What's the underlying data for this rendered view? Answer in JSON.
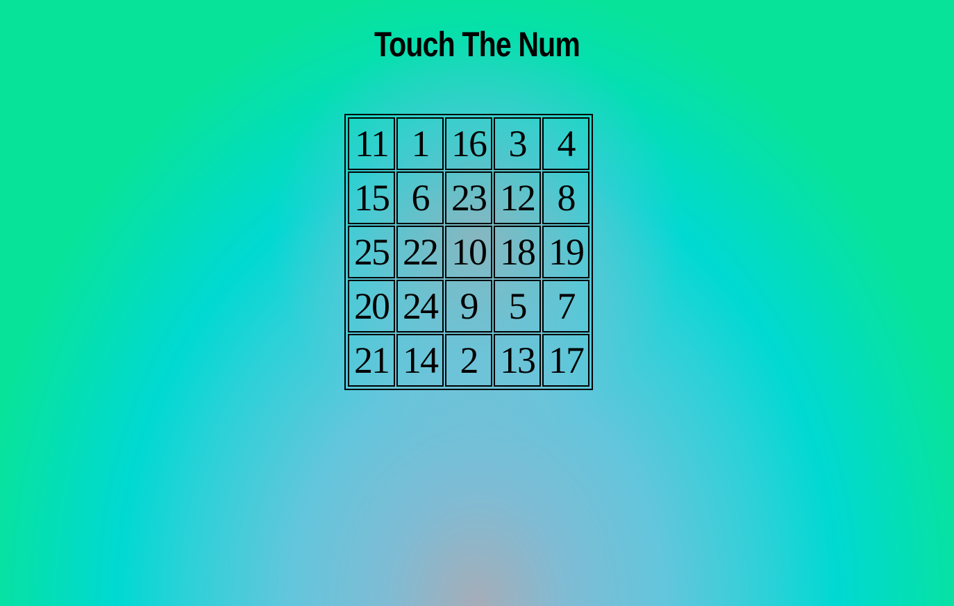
{
  "title": "Touch The Num",
  "board": {
    "rows": [
      [
        11,
        1,
        16,
        3,
        4
      ],
      [
        15,
        6,
        23,
        12,
        8
      ],
      [
        25,
        22,
        10,
        18,
        19
      ],
      [
        20,
        24,
        9,
        5,
        7
      ],
      [
        21,
        14,
        2,
        13,
        17
      ]
    ]
  }
}
